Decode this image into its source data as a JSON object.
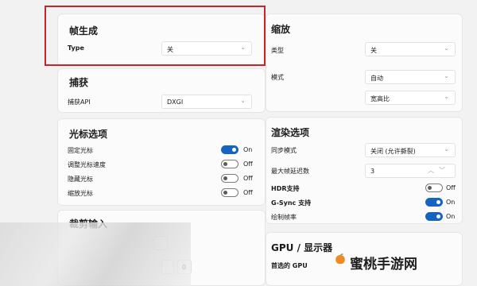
{
  "frame_gen": {
    "title": "帧生成",
    "type_label": "Type",
    "type_value": "关"
  },
  "capture": {
    "title": "捕获",
    "api_label": "捕获API",
    "api_value": "DXGI"
  },
  "cursor": {
    "title": "光标选项",
    "items": [
      {
        "label": "固定光标",
        "state": "On"
      },
      {
        "label": "调整光标速度",
        "state": "Off"
      },
      {
        "label": "隐藏光标",
        "state": "Off"
      },
      {
        "label": "缩放光标",
        "state": "Off"
      }
    ]
  },
  "crop": {
    "title": "裁剪输入",
    "value": "0"
  },
  "scale": {
    "title": "缩放",
    "type_label": "类型",
    "type_value": "关",
    "mode_label": "模式",
    "mode_value": "自动",
    "ratio_value": "宽高比"
  },
  "render": {
    "title": "渲染选项",
    "sync_label": "同步模式",
    "sync_value": "关闭 (允许撕裂)",
    "frames_label": "最大帧延迟数",
    "frames_value": "3",
    "toggles": [
      {
        "label": "HDR支持",
        "state": "Off"
      },
      {
        "label": "G-Sync 支持",
        "state": "On"
      },
      {
        "label": "绘制帧率",
        "state": "On"
      }
    ]
  },
  "gpu": {
    "title": "GPU / 显示器",
    "preferred_label": "首选的 GPU"
  },
  "watermark": {
    "text": "蜜桃手游网"
  }
}
